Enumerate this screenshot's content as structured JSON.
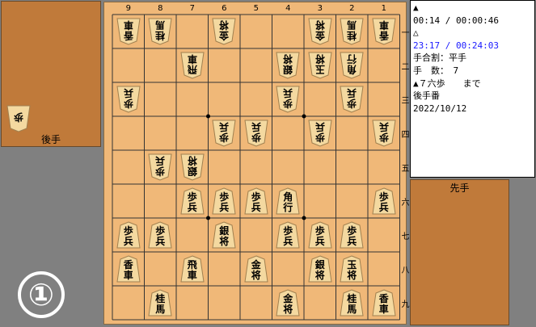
{
  "gote_stand": {
    "label": "後手",
    "pieces": [
      {
        "kanji": "歩",
        "owner": "gote"
      }
    ]
  },
  "sente_stand": {
    "label": "先手",
    "pieces": []
  },
  "board": {
    "files": [
      "9",
      "8",
      "7",
      "6",
      "5",
      "4",
      "3",
      "2",
      "1"
    ],
    "ranks": [
      "一",
      "二",
      "三",
      "四",
      "五",
      "六",
      "七",
      "八",
      "九"
    ],
    "pieces": [
      {
        "file": 9,
        "rank": 1,
        "kanji": "香車",
        "owner": "gote"
      },
      {
        "file": 8,
        "rank": 1,
        "kanji": "桂馬",
        "owner": "gote"
      },
      {
        "file": 6,
        "rank": 1,
        "kanji": "金将",
        "owner": "gote"
      },
      {
        "file": 3,
        "rank": 1,
        "kanji": "金将",
        "owner": "gote"
      },
      {
        "file": 2,
        "rank": 1,
        "kanji": "桂馬",
        "owner": "gote"
      },
      {
        "file": 1,
        "rank": 1,
        "kanji": "香車",
        "owner": "gote"
      },
      {
        "file": 7,
        "rank": 2,
        "kanji": "飛車",
        "owner": "gote"
      },
      {
        "file": 4,
        "rank": 2,
        "kanji": "銀将",
        "owner": "gote"
      },
      {
        "file": 3,
        "rank": 2,
        "kanji": "玉将",
        "owner": "gote"
      },
      {
        "file": 2,
        "rank": 2,
        "kanji": "角行",
        "owner": "gote"
      },
      {
        "file": 9,
        "rank": 3,
        "kanji": "歩兵",
        "owner": "gote"
      },
      {
        "file": 4,
        "rank": 3,
        "kanji": "歩兵",
        "owner": "gote"
      },
      {
        "file": 2,
        "rank": 3,
        "kanji": "歩兵",
        "owner": "gote"
      },
      {
        "file": 6,
        "rank": 4,
        "kanji": "歩兵",
        "owner": "gote"
      },
      {
        "file": 5,
        "rank": 4,
        "kanji": "歩兵",
        "owner": "gote"
      },
      {
        "file": 3,
        "rank": 4,
        "kanji": "歩兵",
        "owner": "gote"
      },
      {
        "file": 1,
        "rank": 4,
        "kanji": "歩兵",
        "owner": "gote"
      },
      {
        "file": 8,
        "rank": 5,
        "kanji": "歩兵",
        "owner": "gote"
      },
      {
        "file": 7,
        "rank": 5,
        "kanji": "銀将",
        "owner": "gote"
      },
      {
        "file": 7,
        "rank": 6,
        "kanji": "歩兵",
        "owner": "sente"
      },
      {
        "file": 6,
        "rank": 6,
        "kanji": "歩兵",
        "owner": "sente"
      },
      {
        "file": 5,
        "rank": 6,
        "kanji": "歩兵",
        "owner": "sente"
      },
      {
        "file": 4,
        "rank": 6,
        "kanji": "角行",
        "owner": "sente"
      },
      {
        "file": 1,
        "rank": 6,
        "kanji": "歩兵",
        "owner": "sente"
      },
      {
        "file": 9,
        "rank": 7,
        "kanji": "歩兵",
        "owner": "sente"
      },
      {
        "file": 8,
        "rank": 7,
        "kanji": "歩兵",
        "owner": "sente"
      },
      {
        "file": 6,
        "rank": 7,
        "kanji": "銀将",
        "owner": "sente"
      },
      {
        "file": 4,
        "rank": 7,
        "kanji": "歩兵",
        "owner": "sente"
      },
      {
        "file": 3,
        "rank": 7,
        "kanji": "歩兵",
        "owner": "sente"
      },
      {
        "file": 2,
        "rank": 7,
        "kanji": "歩兵",
        "owner": "sente"
      },
      {
        "file": 9,
        "rank": 8,
        "kanji": "香車",
        "owner": "sente"
      },
      {
        "file": 7,
        "rank": 8,
        "kanji": "飛車",
        "owner": "sente"
      },
      {
        "file": 5,
        "rank": 8,
        "kanji": "金将",
        "owner": "sente"
      },
      {
        "file": 3,
        "rank": 8,
        "kanji": "銀将",
        "owner": "sente"
      },
      {
        "file": 2,
        "rank": 8,
        "kanji": "玉将",
        "owner": "sente"
      },
      {
        "file": 8,
        "rank": 9,
        "kanji": "桂馬",
        "owner": "sente"
      },
      {
        "file": 4,
        "rank": 9,
        "kanji": "金将",
        "owner": "sente"
      },
      {
        "file": 2,
        "rank": 9,
        "kanji": "桂馬",
        "owner": "sente"
      },
      {
        "file": 1,
        "rank": 9,
        "kanji": "香車",
        "owner": "sente"
      }
    ]
  },
  "info": {
    "sente_mark": "▲",
    "sente_time": "00:14 / 00:00:46",
    "gote_mark": "△",
    "gote_time": "23:17 / 00:24:03",
    "handicap": "手合割：平手",
    "move_count": "手　数：　7",
    "last_move": "▲７六歩　　まで",
    "turn": "後手番",
    "date": "2022/10/12"
  },
  "move_number_badge": "①",
  "colors": {
    "board": "#f0b878",
    "stand": "#c07a3a",
    "background": "#808080",
    "gote_time": "#1a1aff"
  }
}
